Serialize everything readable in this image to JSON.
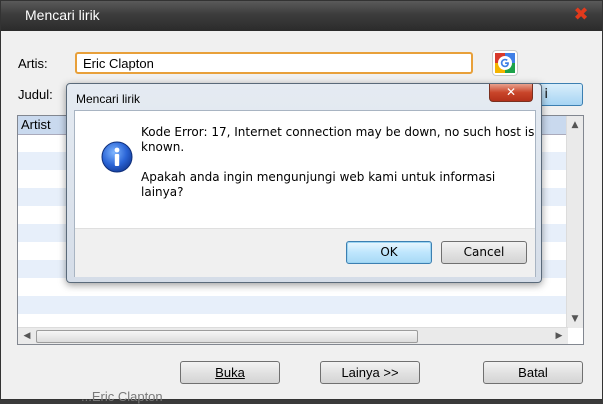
{
  "main": {
    "title": "Mencari lirik",
    "close_glyph": "✖",
    "artis_label": "Artis:",
    "artis_value": "Eric Clapton",
    "judul_label": "Judul:",
    "judul_value": "",
    "cari_button_partial": "i",
    "results_header": "Artist",
    "buttons": {
      "buka": "Buka",
      "lainya": "Lainya >>",
      "batal": "Batal"
    },
    "background_text": "...Eric Clapton"
  },
  "dialog": {
    "title": "Mencari lirik",
    "close_glyph": "✕",
    "message_line1": "Kode Error: 17,  Internet connection may be down, no such host is",
    "message_line2": "known.",
    "message_line3": "Apakah anda ingin  mengunjungi web kami untuk informasi lainya?",
    "ok_label": "OK",
    "cancel_label": "Cancel",
    "icon": "info-icon"
  },
  "colors": {
    "accent_focus": "#e8a03a",
    "dialog_close": "#c9452a",
    "title_bar": "#3c3c3c"
  }
}
